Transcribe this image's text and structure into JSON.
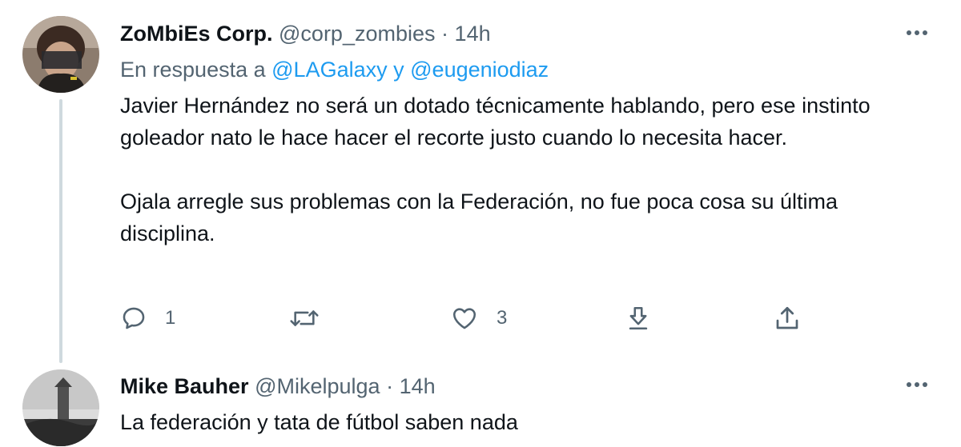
{
  "tweet1": {
    "display_name": "ZoMbiEs Corp.",
    "handle": "@corp_zombies",
    "separator": "·",
    "time": "14h",
    "more_icon": "more-horizontal-icon",
    "reply_to_prefix": "En respuesta a",
    "reply_to_user1": "@LAGalaxy",
    "reply_to_conjunction": "y",
    "reply_to_user2": "@eugeniodiaz",
    "paragraph1": "Javier Hernández no será un dotado técnicamente hablando, pero ese instinto goleador nato le hace hacer el recorte justo cuando lo necesita hacer.",
    "paragraph2": "Ojala arregle sus problemas con la Federación, no fue poca cosa su última disciplina.",
    "actions": {
      "reply_count": "1",
      "retweet_count": "",
      "like_count": "3",
      "icons": [
        "reply-icon",
        "retweet-icon",
        "like-icon",
        "bookmark-icon",
        "share-icon"
      ]
    }
  },
  "tweet2": {
    "display_name": "Mike Bauher",
    "handle": "@Mikelpulga",
    "separator": "·",
    "time": "14h",
    "more_icon": "more-horizontal-icon",
    "text": "La federación y tata de fútbol saben nada"
  },
  "colors": {
    "text_primary": "#0f1419",
    "text_secondary": "#536471",
    "accent": "#1d9bf0",
    "thread_line": "#cfd9de"
  }
}
